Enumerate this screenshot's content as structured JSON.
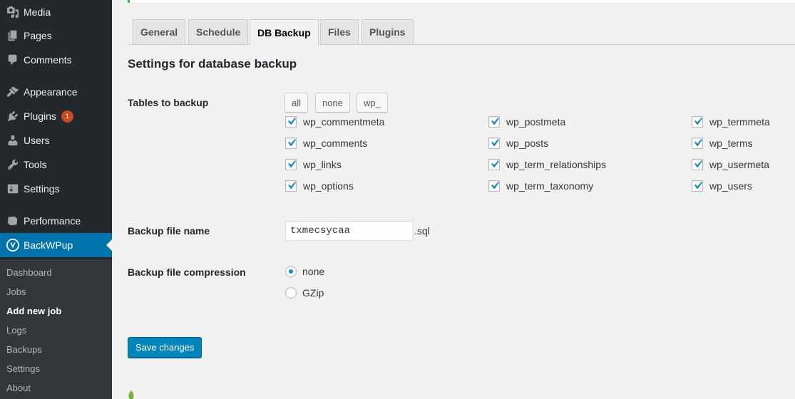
{
  "sidebar": {
    "items": [
      {
        "label": "Media",
        "icon": "media-icon"
      },
      {
        "label": "Pages",
        "icon": "pages-icon"
      },
      {
        "label": "Comments",
        "icon": "comments-icon"
      },
      {
        "label": "Appearance",
        "icon": "appearance-icon"
      },
      {
        "label": "Plugins",
        "icon": "plugins-icon",
        "badge": "1"
      },
      {
        "label": "Users",
        "icon": "users-icon"
      },
      {
        "label": "Tools",
        "icon": "tools-icon"
      },
      {
        "label": "Settings",
        "icon": "settings-icon"
      },
      {
        "label": "Performance",
        "icon": "performance-icon"
      },
      {
        "label": "BackWPup",
        "icon": "backwpup-icon"
      }
    ],
    "submenu": [
      "Dashboard",
      "Jobs",
      "Add new job",
      "Logs",
      "Backups",
      "Settings",
      "About"
    ],
    "active_submenu": "Add new job"
  },
  "tabs": [
    "General",
    "Schedule",
    "DB Backup",
    "Files",
    "Plugins"
  ],
  "active_tab": "DB Backup",
  "section_title": "Settings for database backup",
  "tables": {
    "label": "Tables to backup",
    "buttons": [
      "all",
      "none",
      "wp_"
    ],
    "columns": [
      [
        "wp_commentmeta",
        "wp_comments",
        "wp_links",
        "wp_options"
      ],
      [
        "wp_postmeta",
        "wp_posts",
        "wp_term_relationships",
        "wp_term_taxonomy"
      ],
      [
        "wp_termmeta",
        "wp_terms",
        "wp_usermeta",
        "wp_users"
      ]
    ],
    "all_checked": true
  },
  "filename": {
    "label": "Backup file name",
    "value": "txmecsycaa",
    "extension": ".sql"
  },
  "compression": {
    "label": "Backup file compression",
    "options": [
      "none",
      "GZip"
    ],
    "selected": "none"
  },
  "save_label": "Save changes",
  "colors": {
    "sidebar_bg": "#23282d",
    "submenu_bg": "#32373c",
    "accent": "#0073aa",
    "button_primary": "#0085ba",
    "checkmark": "#1e8cbe",
    "notice_border": "#46b450"
  }
}
